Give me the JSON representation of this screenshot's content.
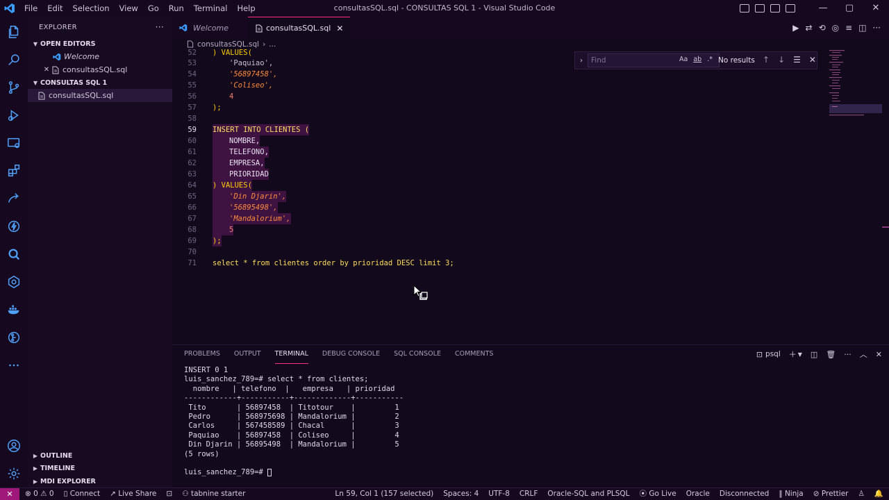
{
  "window": {
    "title": "consultasSQL.sql - CONSULTAS SQL 1 - Visual Studio Code",
    "menu": [
      "File",
      "Edit",
      "Selection",
      "View",
      "Go",
      "Run",
      "Terminal",
      "Help"
    ],
    "controls": {
      "minimize": "—",
      "maximize": "▢",
      "close": "✕"
    }
  },
  "activity_bar": {
    "icons": [
      "files-icon",
      "search-icon",
      "source-control-icon",
      "run-debug-icon",
      "remote-explorer-icon",
      "extensions-icon",
      "live-share-icon",
      "thunder-client-icon",
      "sqltools-icon",
      "kubernetes-icon",
      "docker-icon",
      "gitlens-icon",
      "more-icon",
      "account-icon",
      "settings-gear-icon"
    ]
  },
  "sidebar": {
    "title": "EXPLORER",
    "more": "···",
    "open_editors_label": "OPEN EDITORS",
    "open_editors": [
      {
        "name": "Welcome",
        "italic": true
      },
      {
        "name": "consultasSQL.sql",
        "italic": false
      }
    ],
    "folder_label": "CONSULTAS SQL 1",
    "files": [
      {
        "name": "consultasSQL.sql"
      }
    ],
    "bottom_sections": [
      "OUTLINE",
      "TIMELINE",
      "MDI EXPLORER"
    ]
  },
  "tabs": [
    {
      "label": "Welcome",
      "active": false,
      "italic": true
    },
    {
      "label": "consultasSQL.sql",
      "active": true,
      "italic": false
    }
  ],
  "breadcrumb": {
    "file": "consultasSQL.sql",
    "sep": "›",
    "rest": "..."
  },
  "find": {
    "placeholder": "Find",
    "match_case": "Aa",
    "whole_word": "ab",
    "regex": ".*",
    "result": "No results"
  },
  "editor": {
    "lines": [
      {
        "n": "52",
        "text": ") VALUES("
      },
      {
        "n": "53",
        "text": "'Paquiao',"
      },
      {
        "n": "54",
        "text": "'56897458',"
      },
      {
        "n": "55",
        "text": "'Coliseo',"
      },
      {
        "n": "56",
        "text": "4"
      },
      {
        "n": "57",
        "text": ");"
      },
      {
        "n": "58",
        "text": ""
      },
      {
        "n": "59",
        "text": "INSERT INTO CLIENTES ("
      },
      {
        "n": "60",
        "text": "NOMBRE,"
      },
      {
        "n": "61",
        "text": "TELEFONO,"
      },
      {
        "n": "62",
        "text": "EMPRESA,"
      },
      {
        "n": "63",
        "text": "PRIORIDAD"
      },
      {
        "n": "64",
        "text": ") VALUES("
      },
      {
        "n": "65",
        "text": "'Din Djarin',"
      },
      {
        "n": "66",
        "text": "'56895498',"
      },
      {
        "n": "67",
        "text": "'Mandalorium',"
      },
      {
        "n": "68",
        "text": "5"
      },
      {
        "n": "69",
        "text": ");"
      },
      {
        "n": "70",
        "text": ""
      },
      {
        "n": "71",
        "text": "select * from clientes order by prioridad DESC limit 3;"
      }
    ]
  },
  "panel": {
    "tabs": [
      "PROBLEMS",
      "OUTPUT",
      "TERMINAL",
      "DEBUG CONSOLE",
      "SQL CONSOLE",
      "COMMENTS"
    ],
    "active_tab": "TERMINAL",
    "shell": "psql",
    "terminal_lines": [
      "INSERT 0 1",
      "luis_sanchez_789=# select * from clientes;",
      "  nombre   | telefono  |   empresa   | prioridad",
      "------------+-----------+-------------+-----------",
      " Tito       | 56897458  | Titotour    |         1",
      " Pedro      | 568975698 | Mandalorium |         2",
      " Carlos     | 567458589 | Chacal      |         3",
      " Paquiao    | 56897458  | Coliseo     |         4",
      " Din Djarin | 56895498  | Mandalorium |         5",
      "(5 rows)",
      "",
      "luis_sanchez_789=# "
    ]
  },
  "statusbar": {
    "remote": "✕",
    "problems": "⊗ 0  ⚠ 0",
    "connect": "Connect",
    "live_share": "Live Share",
    "tabnine": "tabnine starter",
    "position": "Ln 59, Col 1 (157 selected)",
    "spaces": "Spaces: 4",
    "encoding": "UTF-8",
    "eol": "CRLF",
    "language": "Oracle-SQL and PLSQL",
    "go_live": "Go Live",
    "oracle": "Oracle",
    "connection": "Disconnected",
    "ninja": "Ninja",
    "prettier": "Prettier"
  }
}
